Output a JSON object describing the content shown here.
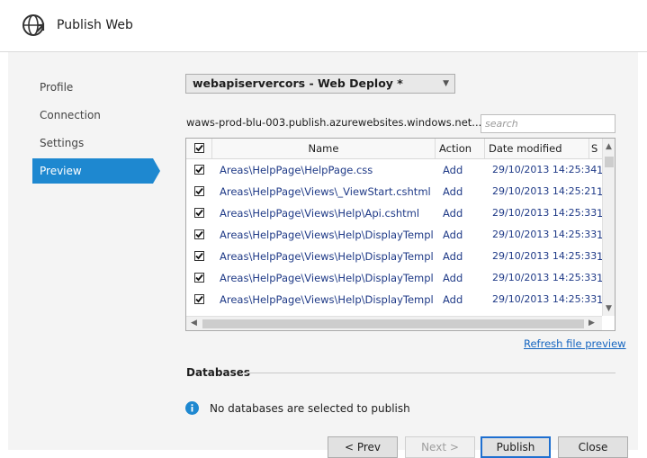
{
  "window": {
    "title": "Publish Web",
    "icon": "globe-publish-icon"
  },
  "nav": {
    "items": [
      {
        "label": "Profile"
      },
      {
        "label": "Connection"
      },
      {
        "label": "Settings"
      },
      {
        "label": "Preview",
        "active": true
      }
    ]
  },
  "profile": {
    "selected": "webapiservercors - Web Deploy *"
  },
  "server": {
    "url": "waws-prod-blu-003.publish.azurewebsites.windows.net..."
  },
  "search": {
    "placeholder": "search",
    "value": ""
  },
  "grid": {
    "columns": {
      "name": "Name",
      "action": "Action",
      "date": "Date modified",
      "size": "S"
    },
    "rows": [
      {
        "name": "Areas\\HelpPage\\HelpPage.css",
        "action": "Add",
        "date": "29/10/2013 14:25:34",
        "size": "1"
      },
      {
        "name": "Areas\\HelpPage\\Views\\_ViewStart.cshtml",
        "action": "Add",
        "date": "29/10/2013 14:25:21",
        "size": "1"
      },
      {
        "name": "Areas\\HelpPage\\Views\\Help\\Api.cshtml",
        "action": "Add",
        "date": "29/10/2013 14:25:33",
        "size": "1"
      },
      {
        "name": "Areas\\HelpPage\\Views\\Help\\DisplayTemplates",
        "action": "Add",
        "date": "29/10/2013 14:25:33",
        "size": "1"
      },
      {
        "name": "Areas\\HelpPage\\Views\\Help\\DisplayTemplates",
        "action": "Add",
        "date": "29/10/2013 14:25:33",
        "size": "1"
      },
      {
        "name": "Areas\\HelpPage\\Views\\Help\\DisplayTemplates",
        "action": "Add",
        "date": "29/10/2013 14:25:33",
        "size": "1"
      },
      {
        "name": "Areas\\HelpPage\\Views\\Help\\DisplayTemplates",
        "action": "Add",
        "date": "29/10/2013 14:25:33",
        "size": "1"
      }
    ]
  },
  "refresh": {
    "label": "Refresh file preview"
  },
  "databases": {
    "title": "Databases",
    "message": "No databases are selected to publish"
  },
  "buttons": {
    "prev": "< Prev",
    "next": "Next >",
    "publish": "Publish",
    "close": "Close"
  },
  "colors": {
    "accent": "#1e88d0",
    "link": "#1565c0",
    "row_text": "#1f3a87"
  }
}
